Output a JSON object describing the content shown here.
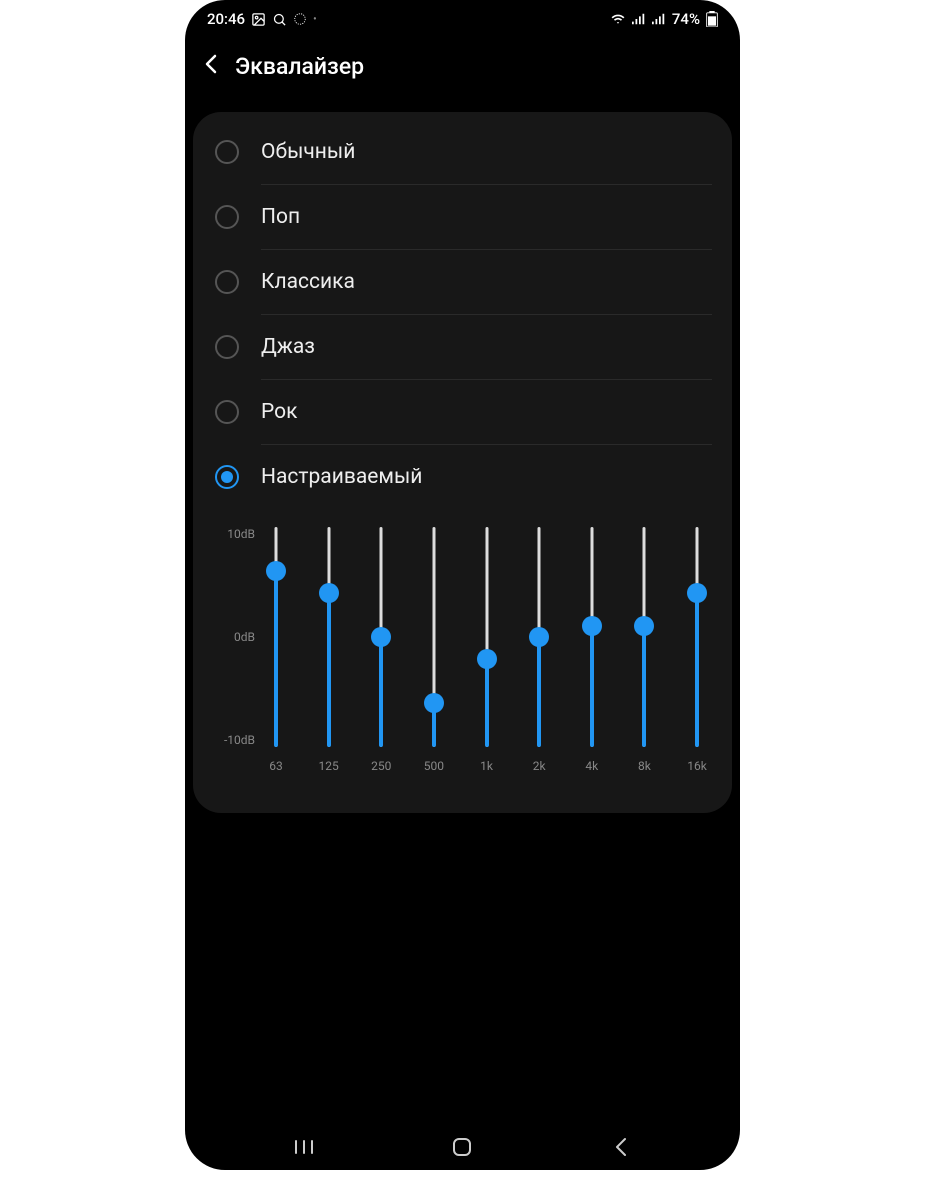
{
  "statusbar": {
    "time": "20:46",
    "battery": "74%"
  },
  "appbar": {
    "title": "Эквалайзер"
  },
  "presets": [
    {
      "label": "Обычный",
      "selected": false
    },
    {
      "label": "Поп",
      "selected": false
    },
    {
      "label": "Классика",
      "selected": false
    },
    {
      "label": "Джаз",
      "selected": false
    },
    {
      "label": "Рок",
      "selected": false
    },
    {
      "label": "Настраиваемый",
      "selected": true
    }
  ],
  "chart_data": {
    "type": "bar",
    "categories": [
      "63",
      "125",
      "250",
      "500",
      "1k",
      "2k",
      "4k",
      "8k",
      "16k"
    ],
    "values": [
      6,
      4,
      0,
      -6,
      -2,
      0,
      1,
      1,
      4
    ],
    "ylim": [
      -10,
      10
    ],
    "yticks": [
      "10dB",
      "0dB",
      "-10dB"
    ],
    "ylabel": "",
    "xlabel": ""
  }
}
